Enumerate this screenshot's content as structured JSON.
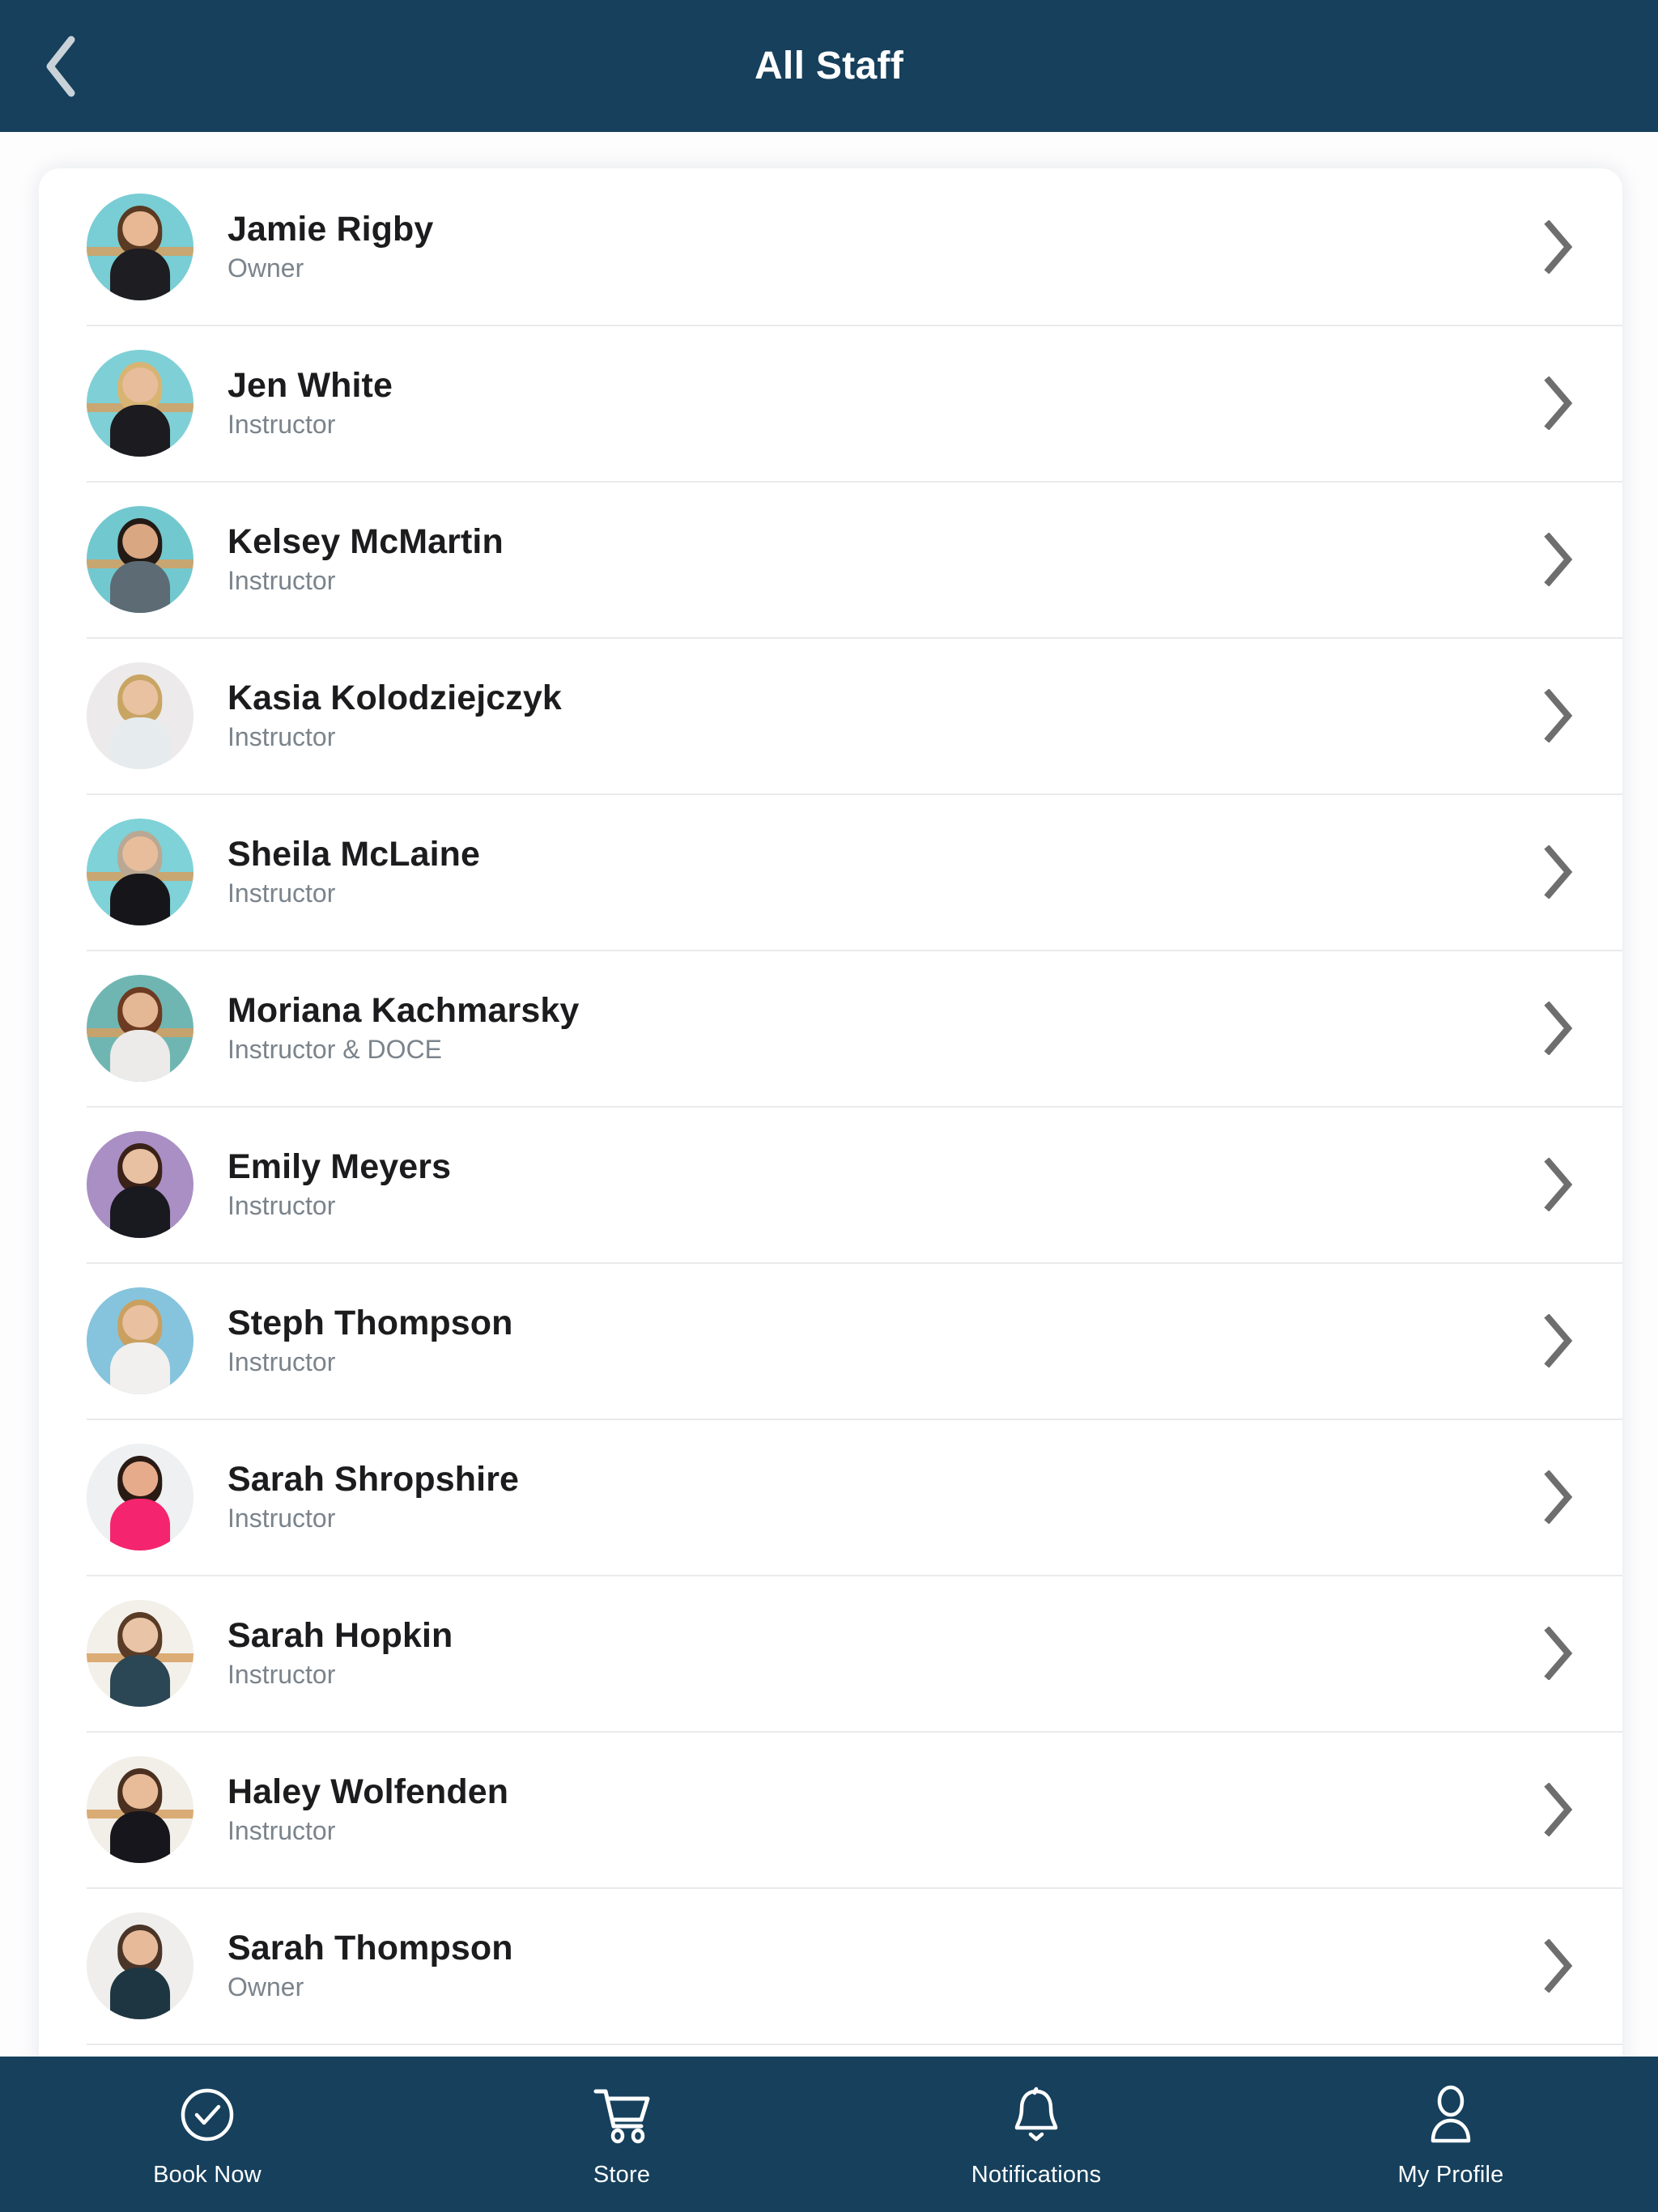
{
  "header": {
    "title": "All Staff",
    "back_icon": "chevron-left-icon",
    "background_color": "#16405c",
    "title_color": "#ffffff"
  },
  "staff_list": {
    "row_chevron_icon": "chevron-right-icon",
    "items": [
      {
        "name": "Jamie Rigby",
        "role": "Owner",
        "avatar": {
          "bg": "#79cdd4",
          "skin": "#e8b894",
          "hair": "#5a3a22",
          "top": "#1d1d22",
          "barre": true
        }
      },
      {
        "name": "Jen White",
        "role": "Instructor",
        "avatar": {
          "bg": "#7fd0d6",
          "skin": "#e8bd9c",
          "hair": "#d8b473",
          "top": "#1b1b20",
          "barre": true
        }
      },
      {
        "name": "Kelsey McMartin",
        "role": "Instructor",
        "avatar": {
          "bg": "#72c8cf",
          "skin": "#d9a782",
          "hair": "#231a16",
          "top": "#5c6b74",
          "barre": true
        }
      },
      {
        "name": "Kasia Kolodziejczyk",
        "role": "Instructor",
        "avatar": {
          "bg": "#eceaea",
          "skin": "#e9c2a2",
          "hair": "#c9a564",
          "top": "#e6ecee",
          "barre": false
        }
      },
      {
        "name": "Sheila McLaine",
        "role": "Instructor",
        "avatar": {
          "bg": "#7ed2d8",
          "skin": "#e7bd9c",
          "hair": "#b9a893",
          "top": "#16161a",
          "barre": true
        }
      },
      {
        "name": "Moriana Kachmarsky",
        "role": "Instructor & DOCE",
        "avatar": {
          "bg": "#6fb6b2",
          "skin": "#e4b795",
          "hair": "#6d3a22",
          "top": "#edeaea",
          "barre": true
        }
      },
      {
        "name": "Emily Meyers",
        "role": "Instructor",
        "avatar": {
          "bg": "#a98fc4",
          "skin": "#e8c0a2",
          "hair": "#3a2218",
          "top": "#191920",
          "barre": false
        }
      },
      {
        "name": "Steph Thompson",
        "role": "Instructor",
        "avatar": {
          "bg": "#86c4dd",
          "skin": "#e9c1a1",
          "hair": "#caa060",
          "top": "#f2f0ee",
          "barre": false
        }
      },
      {
        "name": "Sarah Shropshire",
        "role": "Instructor",
        "avatar": {
          "bg": "#eef0f1",
          "skin": "#e6ab8a",
          "hair": "#2a1a14",
          "top": "#f4246e",
          "barre": false
        }
      },
      {
        "name": "Sarah Hopkin",
        "role": "Instructor",
        "avatar": {
          "bg": "#f3f0ea",
          "skin": "#eac4a6",
          "hair": "#5a3b26",
          "top": "#2b4654",
          "barre": true
        }
      },
      {
        "name": "Haley Wolfenden",
        "role": "Instructor",
        "avatar": {
          "bg": "#f2efe9",
          "skin": "#e8bb99",
          "hair": "#4b3020",
          "top": "#16161c",
          "barre": true
        }
      },
      {
        "name": "Sarah Thompson",
        "role": "Owner",
        "avatar": {
          "bg": "#efeeec",
          "skin": "#e7bb9a",
          "hair": "#4a3528",
          "top": "#1e3642",
          "barre": false
        }
      }
    ],
    "partial_next_item": {
      "avatar": {
        "bg": "#62a8a4",
        "skin": "#e2a87e",
        "hair": "#6a4026",
        "top": "#1c1c22",
        "barre": false
      }
    }
  },
  "tabbar": {
    "background_color": "#16405c",
    "label_color": "#ffffff",
    "tabs": [
      {
        "label": "Book Now",
        "icon": "check-circle-icon"
      },
      {
        "label": "Store",
        "icon": "shopping-cart-icon"
      },
      {
        "label": "Notifications",
        "icon": "bell-icon"
      },
      {
        "label": "My Profile",
        "icon": "person-icon"
      }
    ]
  }
}
